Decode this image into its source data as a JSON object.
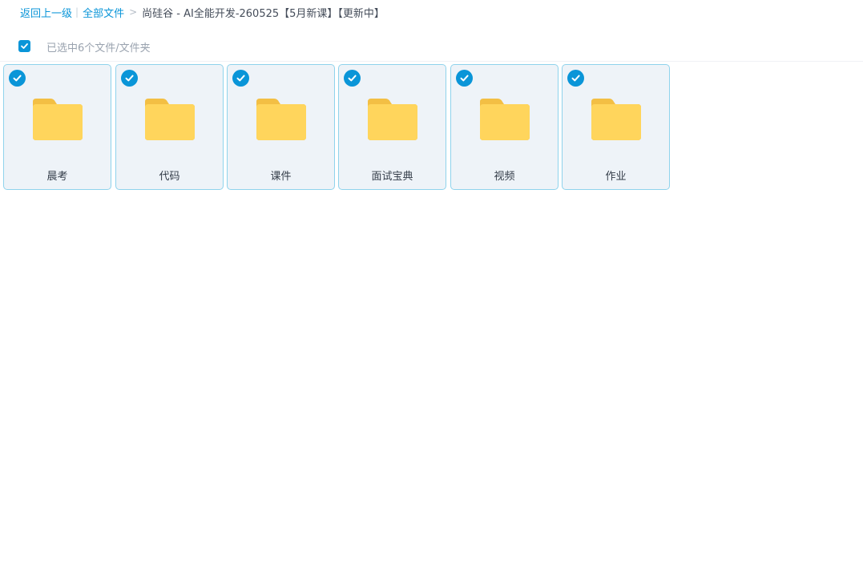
{
  "breadcrumb": {
    "back_label": "返回上一级",
    "separator_bar": "|",
    "root_label": "全部文件",
    "separator_arrow": ">",
    "current_label": "尚硅谷 - AI全能开发-260525【5月新课】【更新中】"
  },
  "selection": {
    "checked": true,
    "status_text": "已选中6个文件/文件夹"
  },
  "files": [
    {
      "name": "晨考",
      "type": "folder",
      "selected": true
    },
    {
      "name": "代码",
      "type": "folder",
      "selected": true
    },
    {
      "name": "课件",
      "type": "folder",
      "selected": true
    },
    {
      "name": "面试宝典",
      "type": "folder",
      "selected": true
    },
    {
      "name": "视频",
      "type": "folder",
      "selected": true
    },
    {
      "name": "作业",
      "type": "folder",
      "selected": true
    }
  ],
  "icons": {
    "check": "check-icon",
    "folder": "folder-icon"
  },
  "colors": {
    "accent": "#0a95d8",
    "tile_bg": "#eef3f8",
    "tile_border": "#8fd3ec",
    "folder_front": "#ffd55c",
    "folder_back": "#f3bf44"
  }
}
